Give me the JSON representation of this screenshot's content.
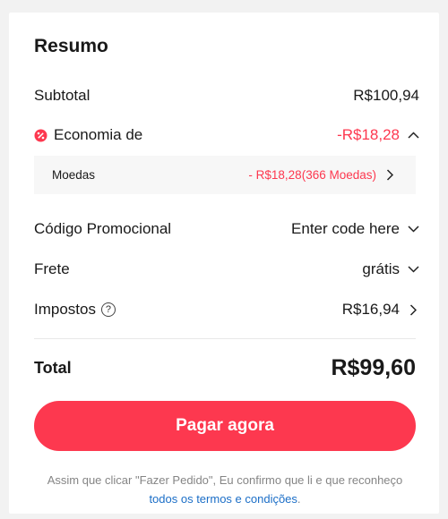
{
  "summary": {
    "title": "Resumo",
    "subtotal": {
      "label": "Subtotal",
      "value": "R$100,94"
    },
    "savings": {
      "label": "Economia de",
      "value": "-R$18,28",
      "icon": "discount-badge-icon"
    },
    "coins": {
      "label": "Moedas",
      "value": "- R$18,28(366 Moedas)"
    },
    "promo": {
      "label": "Código Promocional",
      "value": "Enter code here"
    },
    "shipping": {
      "label": "Frete",
      "value": "grátis"
    },
    "taxes": {
      "label": "Impostos",
      "value": "R$16,94",
      "help_symbol": "?"
    },
    "total": {
      "label": "Total",
      "value": "R$99,60"
    },
    "pay_button": "Pagar agora",
    "disclaimer": {
      "text": "Assim que clicar \"Fazer Pedido\", Eu confirmo que li e que reconheço ",
      "link": "todos os termos e condições",
      "suffix": "."
    }
  },
  "colors": {
    "accent": "#fd384f",
    "link": "#1b6ec7",
    "muted": "#858585",
    "background": "#f2f2f2"
  }
}
